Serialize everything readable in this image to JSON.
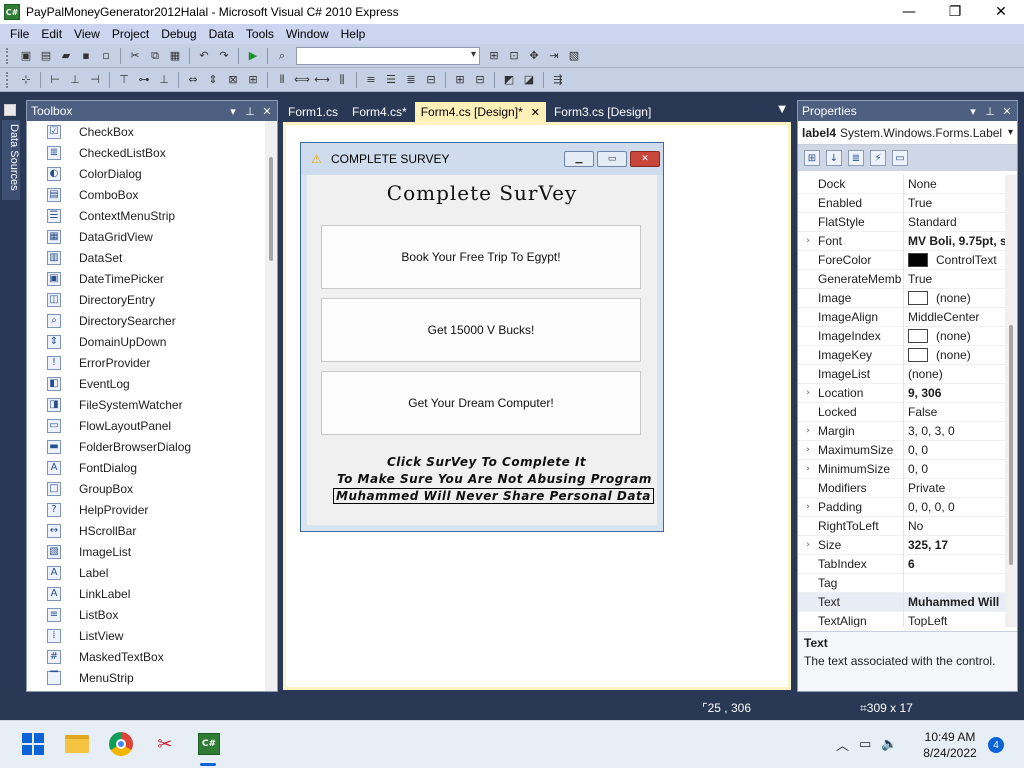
{
  "window": {
    "title": "PayPalMoneyGenerator2012Halal - Microsoft Visual C# 2010 Express",
    "icon": "C#",
    "minimize": "—",
    "maximize": "❐",
    "close": "✕"
  },
  "menu": [
    "File",
    "Edit",
    "View",
    "Project",
    "Debug",
    "Data",
    "Tools",
    "Window",
    "Help"
  ],
  "side_tab": {
    "label": "Data Sources"
  },
  "toolbox": {
    "title": "Toolbox",
    "pin": "▾",
    "autohide": "⊥",
    "close": "✕",
    "items": [
      {
        "label": "CheckBox",
        "icon": "☑"
      },
      {
        "label": "CheckedListBox",
        "icon": "≣"
      },
      {
        "label": "ColorDialog",
        "icon": "◐"
      },
      {
        "label": "ComboBox",
        "icon": "▤"
      },
      {
        "label": "ContextMenuStrip",
        "icon": "☰"
      },
      {
        "label": "DataGridView",
        "icon": "▦"
      },
      {
        "label": "DataSet",
        "icon": "▥"
      },
      {
        "label": "DateTimePicker",
        "icon": "▣"
      },
      {
        "label": "DirectoryEntry",
        "icon": "◫"
      },
      {
        "label": "DirectorySearcher",
        "icon": "⌕"
      },
      {
        "label": "DomainUpDown",
        "icon": "⇕"
      },
      {
        "label": "ErrorProvider",
        "icon": "!"
      },
      {
        "label": "EventLog",
        "icon": "◧"
      },
      {
        "label": "FileSystemWatcher",
        "icon": "◨"
      },
      {
        "label": "FlowLayoutPanel",
        "icon": "▭"
      },
      {
        "label": "FolderBrowserDialog",
        "icon": "▬"
      },
      {
        "label": "FontDialog",
        "icon": "A"
      },
      {
        "label": "GroupBox",
        "icon": "□"
      },
      {
        "label": "HelpProvider",
        "icon": "?"
      },
      {
        "label": "HScrollBar",
        "icon": "↔"
      },
      {
        "label": "ImageList",
        "icon": "▧"
      },
      {
        "label": "Label",
        "icon": "A"
      },
      {
        "label": "LinkLabel",
        "icon": "A"
      },
      {
        "label": "ListBox",
        "icon": "≡"
      },
      {
        "label": "ListView",
        "icon": "⁞"
      },
      {
        "label": "MaskedTextBox",
        "icon": "#"
      },
      {
        "label": "MenuStrip",
        "icon": "▔"
      }
    ]
  },
  "tabs": [
    {
      "label": "Form1.cs",
      "active": false
    },
    {
      "label": "Form4.cs*",
      "active": false
    },
    {
      "label": "Form4.cs [Design]*",
      "active": true
    },
    {
      "label": "Form3.cs [Design]",
      "active": false
    }
  ],
  "tab_close": "✕",
  "tab_menu": "▼",
  "form": {
    "caption": "COMPLETE SURVEY",
    "heading": "Complete SurVey",
    "buttons": [
      "Book Your Free Trip To Egypt!",
      "Get 15000 V Bucks!",
      "Get Your Dream Computer!"
    ],
    "labels": [
      "Click SurVey To Complete It",
      "To Make Sure You Are Not Abusing Program",
      "Muhammed Will Never Share Personal Data"
    ]
  },
  "properties": {
    "title": "Properties",
    "object_name": "label4",
    "object_type": "System.Windows.Forms.Label",
    "rows": [
      {
        "name": "Dock",
        "value": "None",
        "expand": "",
        "bold": false
      },
      {
        "name": "Enabled",
        "value": "True",
        "expand": "",
        "bold": false
      },
      {
        "name": "FlatStyle",
        "value": "Standard",
        "expand": "",
        "bold": false
      },
      {
        "name": "Font",
        "value": "MV Boli, 9.75pt, s",
        "expand": "›",
        "bold": true
      },
      {
        "name": "ForeColor",
        "value": "ControlText",
        "expand": "",
        "bold": false,
        "swatch": "#000000"
      },
      {
        "name": "GenerateMemb",
        "value": "True",
        "expand": "",
        "bold": false
      },
      {
        "name": "Image",
        "value": "(none)",
        "expand": "",
        "bold": false,
        "swatch": "#ffffff"
      },
      {
        "name": "ImageAlign",
        "value": "MiddleCenter",
        "expand": "",
        "bold": false
      },
      {
        "name": "ImageIndex",
        "value": "(none)",
        "expand": "",
        "bold": false,
        "swatch": "#ffffff"
      },
      {
        "name": "ImageKey",
        "value": "(none)",
        "expand": "",
        "bold": false,
        "swatch": "#ffffff"
      },
      {
        "name": "ImageList",
        "value": "(none)",
        "expand": "",
        "bold": false
      },
      {
        "name": "Location",
        "value": "9, 306",
        "expand": "›",
        "bold": true
      },
      {
        "name": "Locked",
        "value": "False",
        "expand": "",
        "bold": false
      },
      {
        "name": "Margin",
        "value": "3, 0, 3, 0",
        "expand": "›",
        "bold": false
      },
      {
        "name": "MaximumSize",
        "value": "0, 0",
        "expand": "›",
        "bold": false
      },
      {
        "name": "MinimumSize",
        "value": "0, 0",
        "expand": "›",
        "bold": false
      },
      {
        "name": "Modifiers",
        "value": "Private",
        "expand": "",
        "bold": false
      },
      {
        "name": "Padding",
        "value": "0, 0, 0, 0",
        "expand": "›",
        "bold": false
      },
      {
        "name": "RightToLeft",
        "value": "No",
        "expand": "",
        "bold": false
      },
      {
        "name": "Size",
        "value": "325, 17",
        "expand": "›",
        "bold": true
      },
      {
        "name": "TabIndex",
        "value": "6",
        "expand": "",
        "bold": true
      },
      {
        "name": "Tag",
        "value": "",
        "expand": "",
        "bold": false
      },
      {
        "name": "Text",
        "value": "Muhammed Will",
        "expand": "",
        "bold": true,
        "highlight": true
      },
      {
        "name": "TextAlign",
        "value": "TopLeft",
        "expand": "",
        "bold": false
      }
    ],
    "desc_title": "Text",
    "desc_text": "The text associated with the control."
  },
  "status": {
    "location": "25 , 306",
    "size": "309 x 17"
  },
  "taskbar": {
    "time": "10:49 AM",
    "date": "8/24/2022",
    "notifications": "4",
    "vcs_icon": "C#"
  },
  "colors": {
    "chrome_dark": "#293955",
    "active_tab": "#fff1b8",
    "form_close": "#c9463d"
  }
}
